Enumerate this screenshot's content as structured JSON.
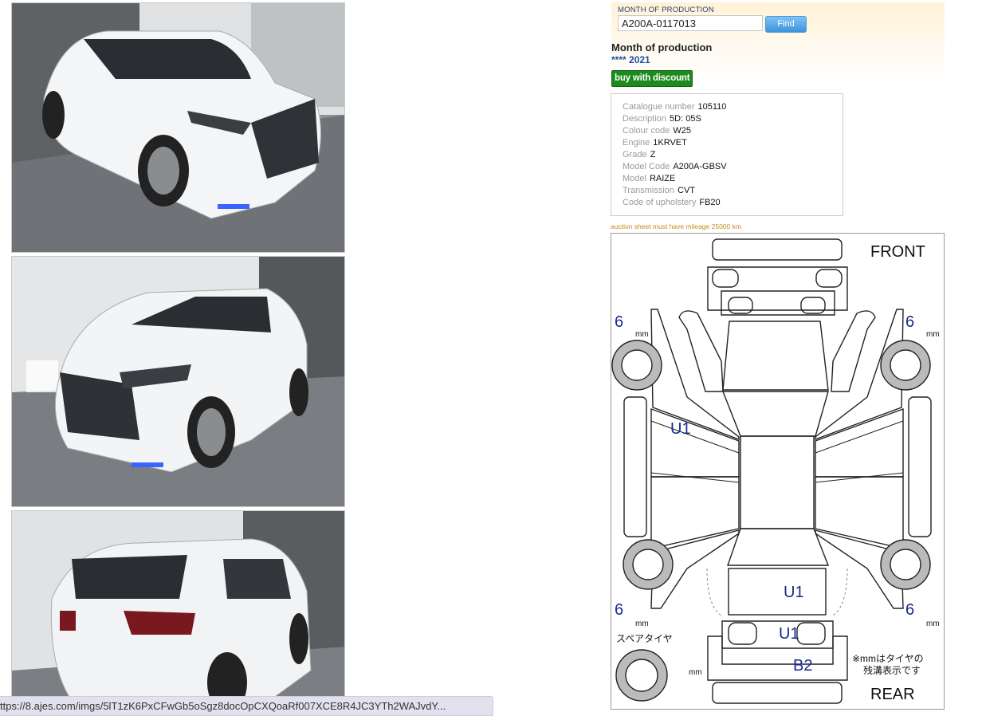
{
  "production": {
    "label": "MONTH OF PRODUCTION",
    "input_value": "A200A-0117013",
    "find_label": "Find"
  },
  "month_of_production": {
    "heading": "Month of production",
    "value": "**** 2021"
  },
  "discount_label": "buy with discount",
  "specs": [
    {
      "key": "Catalogue number",
      "value": "105110"
    },
    {
      "key": "Description",
      "value": "5D: 05S"
    },
    {
      "key": "Colour code",
      "value": "W25"
    },
    {
      "key": "Engine",
      "value": "1KRVET"
    },
    {
      "key": "Grade",
      "value": "Z"
    },
    {
      "key": "Model Code",
      "value": "A200A-GBSV"
    },
    {
      "key": "Model",
      "value": "RAIZE"
    },
    {
      "key": "Transmission",
      "value": "CVT"
    },
    {
      "key": "Code of upholstery",
      "value": "FB20"
    }
  ],
  "sheet_note": "auction sheet must have mileage 25000 km",
  "sheet": {
    "front": "FRONT",
    "rear": "REAR",
    "tread_front_left": "6",
    "tread_front_right": "6",
    "tread_rear_left": "6",
    "tread_rear_right": "6",
    "mm": "mm",
    "spare_tire": "スペアタイヤ",
    "note_line1": "※mmはタイヤの",
    "note_line2": "残溝表示です",
    "mark_left_door": "U1",
    "mark_rear_bumper_upper": "U1",
    "mark_tailgate": "U1",
    "mark_rear_bumper": "B2"
  },
  "status_url": "ttps://8.ajes.com/imgs/5lT1zK6PxCFwGb5oSgz8docOpCXQoaRf007XCE8R4JC3YTh2WAJvdY...",
  "colors": {
    "find_button": "#3d93db",
    "discount_button": "#1c8a1c",
    "link_blue": "#1f4fa3",
    "note_orange": "#c98a1e",
    "mark_blue": "#1a2a8c"
  }
}
